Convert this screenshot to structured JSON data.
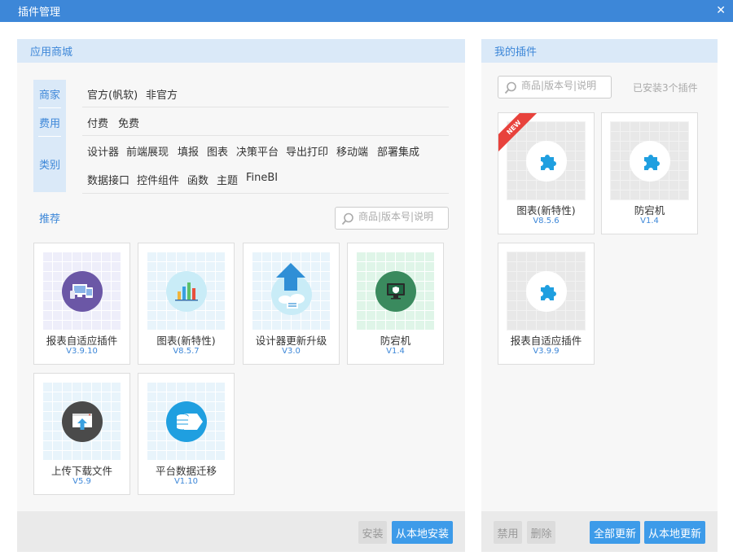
{
  "window": {
    "title": "插件管理",
    "close_symbol": "✕"
  },
  "store": {
    "header": "应用商城",
    "filters": {
      "tabs": [
        "商家",
        "费用",
        "类别"
      ],
      "vendor": {
        "official_prefix": "官方(",
        "official_highlight": "帆软",
        "official_suffix": ")",
        "unofficial": "非官方"
      },
      "fee": [
        "付费",
        "免费"
      ],
      "category_row1": [
        "设计器",
        "前端展现",
        "填报",
        "图表",
        "决策平台",
        "导出打印",
        "移动端",
        "部署集成"
      ],
      "category_row2": [
        "数据接口",
        "控件组件",
        "函数",
        "主题",
        "FineBI"
      ]
    },
    "recommend_label": "推荐",
    "search_placeholder": "商品|版本号|说明",
    "plugins": [
      {
        "name": "报表自适应插件",
        "version": "V3.9.10",
        "icon": "monitor-devices-icon",
        "color": "#6b57a6"
      },
      {
        "name": "图表(新特性)",
        "version": "V8.5.7",
        "icon": "bar-chart-icon",
        "color": "#c9ecf7"
      },
      {
        "name": "设计器更新升级",
        "version": "V3.0",
        "icon": "upload-cloud-icon",
        "color": "#2f8fd6"
      },
      {
        "name": "防宕机",
        "version": "V1.4",
        "icon": "monitor-shield-icon",
        "color": "#3a8a5e"
      },
      {
        "name": "上传下载文件",
        "version": "V5.9",
        "icon": "upload-file-icon",
        "color": "#4a4a4a"
      },
      {
        "name": "平台数据迁移",
        "version": "V1.10",
        "icon": "database-migrate-icon",
        "color": "#1f9fe0"
      }
    ],
    "buttons": {
      "install": "安装",
      "install_local": "从本地安装"
    }
  },
  "mine": {
    "header": "我的插件",
    "search_placeholder": "商品|版本号|说明",
    "installed_count": "已安装3个插件",
    "plugins": [
      {
        "name": "图表(新特性)",
        "version": "V8.5.6",
        "badge": "NEW",
        "icon": "puzzle-icon"
      },
      {
        "name": "防宕机",
        "version": "V1.4",
        "icon": "puzzle-icon"
      },
      {
        "name": "报表自适应插件",
        "version": "V3.9.9",
        "icon": "puzzle-icon"
      }
    ],
    "buttons": {
      "disable": "禁用",
      "delete": "删除",
      "update_all": "全部更新",
      "update_local": "从本地更新"
    }
  },
  "colors": {
    "accent": "#3d87d8",
    "header_bg": "#dae9f8",
    "button_blue": "#3d9be9",
    "new_badge": "#e8423c"
  }
}
